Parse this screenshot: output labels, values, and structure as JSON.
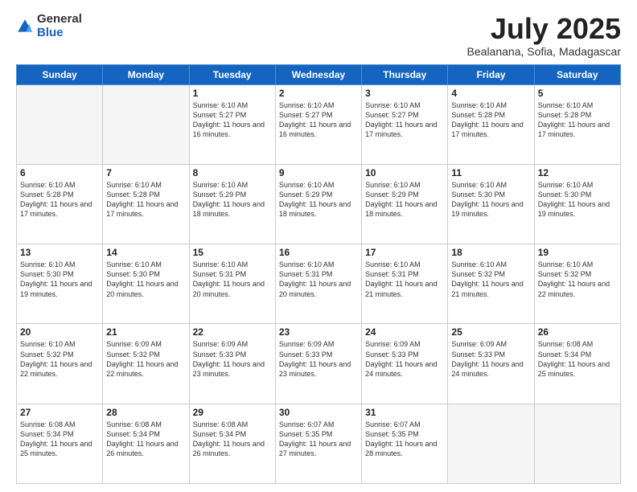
{
  "logo": {
    "general": "General",
    "blue": "Blue"
  },
  "header": {
    "month": "July 2025",
    "location": "Bealanana, Sofia, Madagascar"
  },
  "weekdays": [
    "Sunday",
    "Monday",
    "Tuesday",
    "Wednesday",
    "Thursday",
    "Friday",
    "Saturday"
  ],
  "weeks": [
    [
      {
        "day": "",
        "info": ""
      },
      {
        "day": "",
        "info": ""
      },
      {
        "day": "1",
        "info": "Sunrise: 6:10 AM\nSunset: 5:27 PM\nDaylight: 11 hours and 16 minutes."
      },
      {
        "day": "2",
        "info": "Sunrise: 6:10 AM\nSunset: 5:27 PM\nDaylight: 11 hours and 16 minutes."
      },
      {
        "day": "3",
        "info": "Sunrise: 6:10 AM\nSunset: 5:27 PM\nDaylight: 11 hours and 17 minutes."
      },
      {
        "day": "4",
        "info": "Sunrise: 6:10 AM\nSunset: 5:28 PM\nDaylight: 11 hours and 17 minutes."
      },
      {
        "day": "5",
        "info": "Sunrise: 6:10 AM\nSunset: 5:28 PM\nDaylight: 11 hours and 17 minutes."
      }
    ],
    [
      {
        "day": "6",
        "info": "Sunrise: 6:10 AM\nSunset: 5:28 PM\nDaylight: 11 hours and 17 minutes."
      },
      {
        "day": "7",
        "info": "Sunrise: 6:10 AM\nSunset: 5:28 PM\nDaylight: 11 hours and 17 minutes."
      },
      {
        "day": "8",
        "info": "Sunrise: 6:10 AM\nSunset: 5:29 PM\nDaylight: 11 hours and 18 minutes."
      },
      {
        "day": "9",
        "info": "Sunrise: 6:10 AM\nSunset: 5:29 PM\nDaylight: 11 hours and 18 minutes."
      },
      {
        "day": "10",
        "info": "Sunrise: 6:10 AM\nSunset: 5:29 PM\nDaylight: 11 hours and 18 minutes."
      },
      {
        "day": "11",
        "info": "Sunrise: 6:10 AM\nSunset: 5:30 PM\nDaylight: 11 hours and 19 minutes."
      },
      {
        "day": "12",
        "info": "Sunrise: 6:10 AM\nSunset: 5:30 PM\nDaylight: 11 hours and 19 minutes."
      }
    ],
    [
      {
        "day": "13",
        "info": "Sunrise: 6:10 AM\nSunset: 5:30 PM\nDaylight: 11 hours and 19 minutes."
      },
      {
        "day": "14",
        "info": "Sunrise: 6:10 AM\nSunset: 5:30 PM\nDaylight: 11 hours and 20 minutes."
      },
      {
        "day": "15",
        "info": "Sunrise: 6:10 AM\nSunset: 5:31 PM\nDaylight: 11 hours and 20 minutes."
      },
      {
        "day": "16",
        "info": "Sunrise: 6:10 AM\nSunset: 5:31 PM\nDaylight: 11 hours and 20 minutes."
      },
      {
        "day": "17",
        "info": "Sunrise: 6:10 AM\nSunset: 5:31 PM\nDaylight: 11 hours and 21 minutes."
      },
      {
        "day": "18",
        "info": "Sunrise: 6:10 AM\nSunset: 5:32 PM\nDaylight: 11 hours and 21 minutes."
      },
      {
        "day": "19",
        "info": "Sunrise: 6:10 AM\nSunset: 5:32 PM\nDaylight: 11 hours and 22 minutes."
      }
    ],
    [
      {
        "day": "20",
        "info": "Sunrise: 6:10 AM\nSunset: 5:32 PM\nDaylight: 11 hours and 22 minutes."
      },
      {
        "day": "21",
        "info": "Sunrise: 6:09 AM\nSunset: 5:32 PM\nDaylight: 11 hours and 22 minutes."
      },
      {
        "day": "22",
        "info": "Sunrise: 6:09 AM\nSunset: 5:33 PM\nDaylight: 11 hours and 23 minutes."
      },
      {
        "day": "23",
        "info": "Sunrise: 6:09 AM\nSunset: 5:33 PM\nDaylight: 11 hours and 23 minutes."
      },
      {
        "day": "24",
        "info": "Sunrise: 6:09 AM\nSunset: 5:33 PM\nDaylight: 11 hours and 24 minutes."
      },
      {
        "day": "25",
        "info": "Sunrise: 6:09 AM\nSunset: 5:33 PM\nDaylight: 11 hours and 24 minutes."
      },
      {
        "day": "26",
        "info": "Sunrise: 6:08 AM\nSunset: 5:34 PM\nDaylight: 11 hours and 25 minutes."
      }
    ],
    [
      {
        "day": "27",
        "info": "Sunrise: 6:08 AM\nSunset: 5:34 PM\nDaylight: 11 hours and 25 minutes."
      },
      {
        "day": "28",
        "info": "Sunrise: 6:08 AM\nSunset: 5:34 PM\nDaylight: 11 hours and 26 minutes."
      },
      {
        "day": "29",
        "info": "Sunrise: 6:08 AM\nSunset: 5:34 PM\nDaylight: 11 hours and 26 minutes."
      },
      {
        "day": "30",
        "info": "Sunrise: 6:07 AM\nSunset: 5:35 PM\nDaylight: 11 hours and 27 minutes."
      },
      {
        "day": "31",
        "info": "Sunrise: 6:07 AM\nSunset: 5:35 PM\nDaylight: 11 hours and 28 minutes."
      },
      {
        "day": "",
        "info": ""
      },
      {
        "day": "",
        "info": ""
      }
    ]
  ]
}
